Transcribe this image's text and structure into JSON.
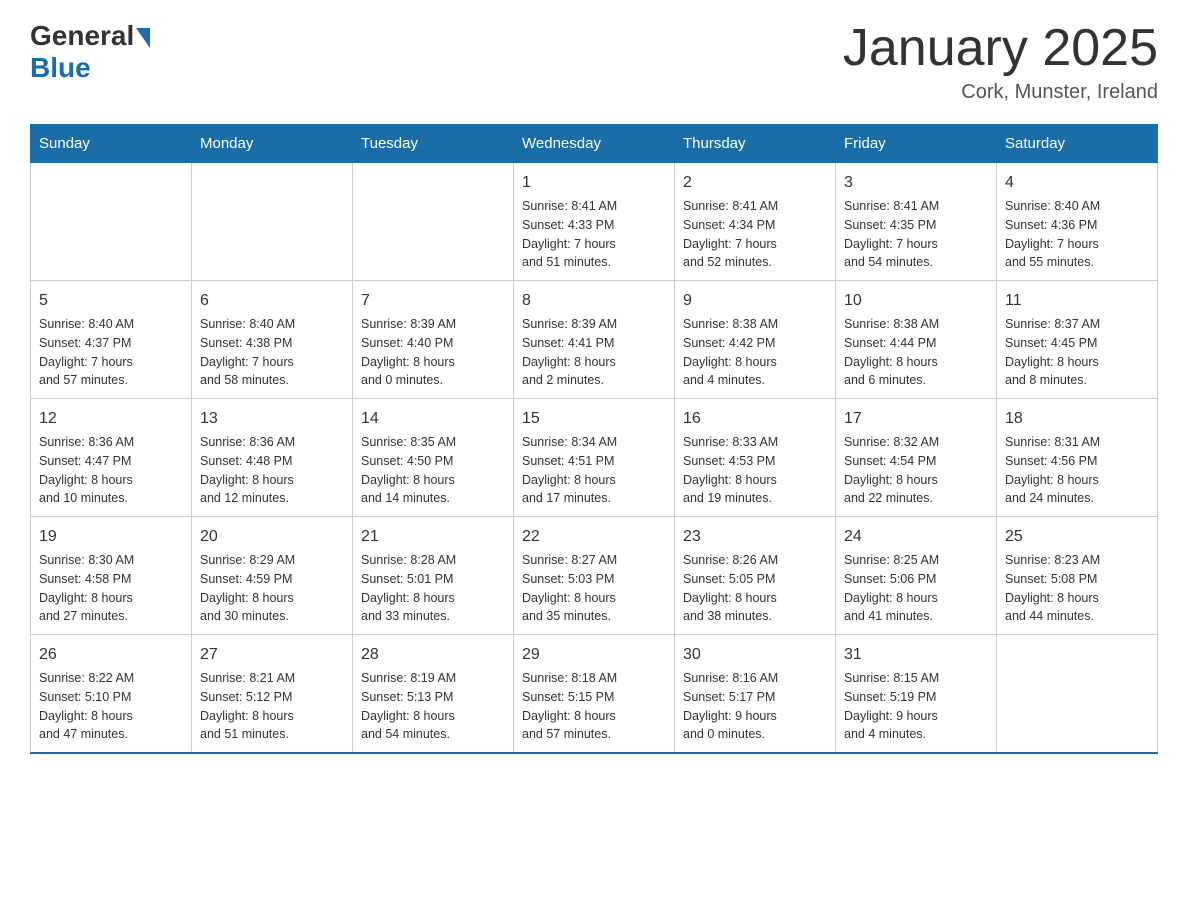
{
  "header": {
    "logo_general": "General",
    "logo_blue": "Blue",
    "month_title": "January 2025",
    "location": "Cork, Munster, Ireland"
  },
  "calendar": {
    "days_of_week": [
      "Sunday",
      "Monday",
      "Tuesday",
      "Wednesday",
      "Thursday",
      "Friday",
      "Saturday"
    ],
    "weeks": [
      [
        {
          "day": "",
          "info": ""
        },
        {
          "day": "",
          "info": ""
        },
        {
          "day": "",
          "info": ""
        },
        {
          "day": "1",
          "info": "Sunrise: 8:41 AM\nSunset: 4:33 PM\nDaylight: 7 hours\nand 51 minutes."
        },
        {
          "day": "2",
          "info": "Sunrise: 8:41 AM\nSunset: 4:34 PM\nDaylight: 7 hours\nand 52 minutes."
        },
        {
          "day": "3",
          "info": "Sunrise: 8:41 AM\nSunset: 4:35 PM\nDaylight: 7 hours\nand 54 minutes."
        },
        {
          "day": "4",
          "info": "Sunrise: 8:40 AM\nSunset: 4:36 PM\nDaylight: 7 hours\nand 55 minutes."
        }
      ],
      [
        {
          "day": "5",
          "info": "Sunrise: 8:40 AM\nSunset: 4:37 PM\nDaylight: 7 hours\nand 57 minutes."
        },
        {
          "day": "6",
          "info": "Sunrise: 8:40 AM\nSunset: 4:38 PM\nDaylight: 7 hours\nand 58 minutes."
        },
        {
          "day": "7",
          "info": "Sunrise: 8:39 AM\nSunset: 4:40 PM\nDaylight: 8 hours\nand 0 minutes."
        },
        {
          "day": "8",
          "info": "Sunrise: 8:39 AM\nSunset: 4:41 PM\nDaylight: 8 hours\nand 2 minutes."
        },
        {
          "day": "9",
          "info": "Sunrise: 8:38 AM\nSunset: 4:42 PM\nDaylight: 8 hours\nand 4 minutes."
        },
        {
          "day": "10",
          "info": "Sunrise: 8:38 AM\nSunset: 4:44 PM\nDaylight: 8 hours\nand 6 minutes."
        },
        {
          "day": "11",
          "info": "Sunrise: 8:37 AM\nSunset: 4:45 PM\nDaylight: 8 hours\nand 8 minutes."
        }
      ],
      [
        {
          "day": "12",
          "info": "Sunrise: 8:36 AM\nSunset: 4:47 PM\nDaylight: 8 hours\nand 10 minutes."
        },
        {
          "day": "13",
          "info": "Sunrise: 8:36 AM\nSunset: 4:48 PM\nDaylight: 8 hours\nand 12 minutes."
        },
        {
          "day": "14",
          "info": "Sunrise: 8:35 AM\nSunset: 4:50 PM\nDaylight: 8 hours\nand 14 minutes."
        },
        {
          "day": "15",
          "info": "Sunrise: 8:34 AM\nSunset: 4:51 PM\nDaylight: 8 hours\nand 17 minutes."
        },
        {
          "day": "16",
          "info": "Sunrise: 8:33 AM\nSunset: 4:53 PM\nDaylight: 8 hours\nand 19 minutes."
        },
        {
          "day": "17",
          "info": "Sunrise: 8:32 AM\nSunset: 4:54 PM\nDaylight: 8 hours\nand 22 minutes."
        },
        {
          "day": "18",
          "info": "Sunrise: 8:31 AM\nSunset: 4:56 PM\nDaylight: 8 hours\nand 24 minutes."
        }
      ],
      [
        {
          "day": "19",
          "info": "Sunrise: 8:30 AM\nSunset: 4:58 PM\nDaylight: 8 hours\nand 27 minutes."
        },
        {
          "day": "20",
          "info": "Sunrise: 8:29 AM\nSunset: 4:59 PM\nDaylight: 8 hours\nand 30 minutes."
        },
        {
          "day": "21",
          "info": "Sunrise: 8:28 AM\nSunset: 5:01 PM\nDaylight: 8 hours\nand 33 minutes."
        },
        {
          "day": "22",
          "info": "Sunrise: 8:27 AM\nSunset: 5:03 PM\nDaylight: 8 hours\nand 35 minutes."
        },
        {
          "day": "23",
          "info": "Sunrise: 8:26 AM\nSunset: 5:05 PM\nDaylight: 8 hours\nand 38 minutes."
        },
        {
          "day": "24",
          "info": "Sunrise: 8:25 AM\nSunset: 5:06 PM\nDaylight: 8 hours\nand 41 minutes."
        },
        {
          "day": "25",
          "info": "Sunrise: 8:23 AM\nSunset: 5:08 PM\nDaylight: 8 hours\nand 44 minutes."
        }
      ],
      [
        {
          "day": "26",
          "info": "Sunrise: 8:22 AM\nSunset: 5:10 PM\nDaylight: 8 hours\nand 47 minutes."
        },
        {
          "day": "27",
          "info": "Sunrise: 8:21 AM\nSunset: 5:12 PM\nDaylight: 8 hours\nand 51 minutes."
        },
        {
          "day": "28",
          "info": "Sunrise: 8:19 AM\nSunset: 5:13 PM\nDaylight: 8 hours\nand 54 minutes."
        },
        {
          "day": "29",
          "info": "Sunrise: 8:18 AM\nSunset: 5:15 PM\nDaylight: 8 hours\nand 57 minutes."
        },
        {
          "day": "30",
          "info": "Sunrise: 8:16 AM\nSunset: 5:17 PM\nDaylight: 9 hours\nand 0 minutes."
        },
        {
          "day": "31",
          "info": "Sunrise: 8:15 AM\nSunset: 5:19 PM\nDaylight: 9 hours\nand 4 minutes."
        },
        {
          "day": "",
          "info": ""
        }
      ]
    ]
  }
}
